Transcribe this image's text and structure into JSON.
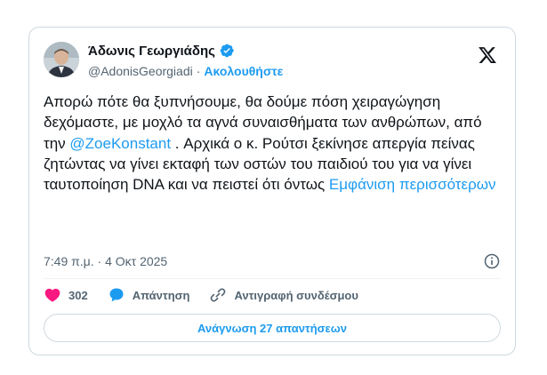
{
  "author": {
    "display_name": "Άδωνις Γεωργιάδης",
    "handle": "@AdonisGeorgiadi",
    "separator": "·",
    "follow_label": "Ακολουθήστε",
    "verified": true
  },
  "tweet": {
    "text_before_mention": "Απορώ  πότε θα ξυπνήσουμε, θα δούμε πόση χειραγώγηση δεχόμαστε, με μοχλό τα αγνά συναισθήματα των ανθρώπων, από την ",
    "mention": "@ZoeKonstant",
    "text_after_mention": " . Αρχικά ο κ. Ρούτσι ξεκίνησε απεργία πείνας ζητώντας να γίνει εκταφή των οστών του παιδιού του για να γίνει ταυτοποίηση DNA και να πειστεί ότι όντως ",
    "show_more_label": "Εμφάνιση περισσότερων",
    "timestamp": "7:49 π.μ. · 4 Οκτ 2025"
  },
  "actions": {
    "like_count": "302",
    "reply_label": "Απάντηση",
    "copy_link_label": "Αντιγραφή συνδέσμου"
  },
  "read_replies_label": "Ανάγνωση 27 απαντήσεων",
  "colors": {
    "accent": "#1d9bf0",
    "like": "#f91880",
    "text": "#0f1419",
    "muted": "#536471",
    "border": "#cfd9de"
  }
}
